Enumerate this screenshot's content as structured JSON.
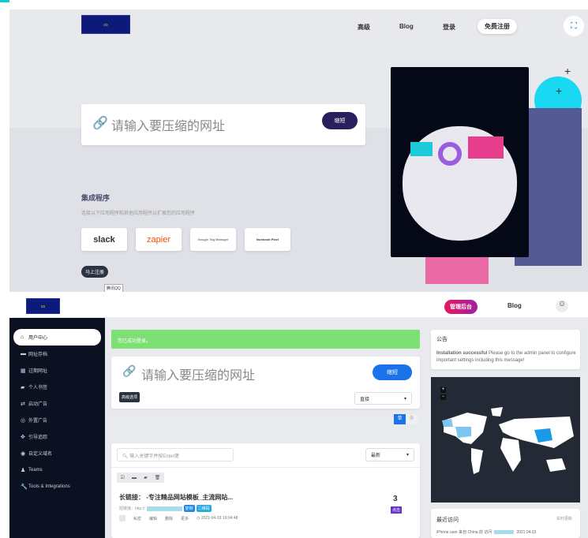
{
  "landing": {
    "nav": {
      "pricing": "高级",
      "blog": "Blog",
      "login": "登录",
      "register": "免费注册"
    },
    "shorten": {
      "placeholder": "请输入要压缩的网址",
      "button": "缩短"
    },
    "integrations": {
      "title": "集成程序",
      "subtitle": "连接以下应用程序和其他应用程序以扩展您的应用程序",
      "items": [
        "slack",
        "zapier",
        "Google Tag Manager",
        "facebook Pixel"
      ]
    },
    "signup_button": "马上注册",
    "tooltip": "腾讯QQ"
  },
  "dashboard": {
    "header": {
      "admin": "管理后台",
      "blog": "Blog"
    },
    "sidebar": {
      "items": [
        {
          "label": "用户中心",
          "icon": "home-icon"
        },
        {
          "label": "网址存档",
          "icon": "archive-icon"
        },
        {
          "label": "过期网址",
          "icon": "calendar-icon"
        },
        {
          "label": "个人书签",
          "icon": "folder-icon"
        },
        {
          "label": "启动广告",
          "icon": "swap-icon"
        },
        {
          "label": "外置广告",
          "icon": "target-icon"
        },
        {
          "label": "引导追踪",
          "icon": "crosshair-icon"
        },
        {
          "label": "自定义域名",
          "icon": "globe-icon"
        },
        {
          "label": "Teams",
          "icon": "user-icon"
        },
        {
          "label": "Tools & Integrations",
          "icon": "wrench-icon"
        }
      ]
    },
    "alert": "您已成功登录。",
    "shorten": {
      "placeholder": "请输入要压缩的网址",
      "button": "缩短",
      "advanced": "高级选项",
      "select": "直接"
    },
    "toggle": {
      "single": "单",
      "multi": "多"
    },
    "search": {
      "placeholder": "输入关键字并按Enter键",
      "sort": "最新"
    },
    "link": {
      "title": "长链接： -专注精品网站模板_主流网站...",
      "short_label": "短链接：http://",
      "copy": "复制",
      "qr": "二维码",
      "actions": [
        "私密",
        "编辑",
        "删除",
        "更多"
      ],
      "date": "2021-04-03 16:04:48",
      "clicks": "3",
      "clicks_label": "点击"
    },
    "notice": {
      "title": "公告",
      "bold": "Installation successful",
      "text": " Please go to the admin panel to configure important settings including this message!"
    },
    "map": {
      "zoom_in": "+",
      "zoom_out": "−"
    },
    "recent": {
      "title": "最近访问",
      "live": "实时更新",
      "entry": "iPhone user 来自 China 前 访问",
      "date": "2021.04.03"
    }
  },
  "colors": {
    "accent": "#1a73e8",
    "dark": "#0b1120",
    "success": "#7ddf74",
    "admin_start": "#e8175d",
    "admin_end": "#9c27b0"
  }
}
